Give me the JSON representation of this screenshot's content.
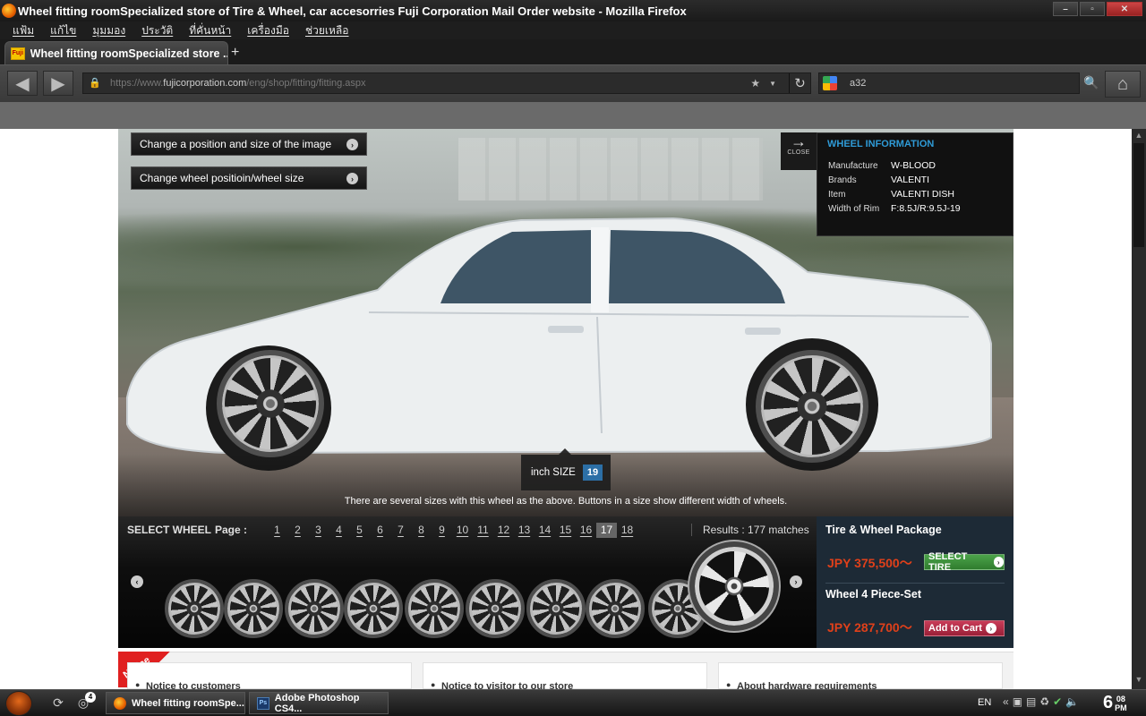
{
  "window": {
    "title": "Wheel fitting roomSpecialized store of Tire & Wheel, car accesorries Fuji Corporation Mail Order website - Mozilla Firefox",
    "controls": [
      "–",
      "▫",
      "✕"
    ]
  },
  "menu": [
    "แฟ้ม",
    "แก้ไข",
    "มุมมอง",
    "ประวัติ",
    "ที่คั่นหน้า",
    "เครื่องมือ",
    "ช่วยเหลือ"
  ],
  "tab": {
    "favicon": "Fuji",
    "label": "Wheel fitting roomSpecialized store ...",
    "new_tab": "+"
  },
  "nav": {
    "url_prefix": "https://www.",
    "url_domain": "fujicorporation.com",
    "url_path": "/eng/shop/fitting/fitting.aspx",
    "search_value": "a32"
  },
  "scene": {
    "btn_position": "Change a position and size of the image",
    "btn_wheel": "Change wheel positioin/wheel size",
    "close_label": "CLOSE",
    "info_title": "WHEEL INFORMATION",
    "info": [
      {
        "k": "Manufacture",
        "v": "W-BLOOD"
      },
      {
        "k": "Brands",
        "v": "VALENTI"
      },
      {
        "k": "Item",
        "v": "VALENTI DISH"
      },
      {
        "k": "Width of Rim",
        "v": "F:8.5J/R:9.5J-19"
      }
    ],
    "inch_label": "inch SIZE",
    "inch_value": "19",
    "note": "There are several sizes with this wheel as the above. Buttons in a size show different width of wheels."
  },
  "selector": {
    "title": "SELECT WHEEL",
    "page_label": "Page :",
    "pages": [
      "1",
      "2",
      "3",
      "4",
      "5",
      "6",
      "7",
      "8",
      "9",
      "10",
      "11",
      "12",
      "13",
      "14",
      "15",
      "16",
      "17",
      "18"
    ],
    "current_page": "17",
    "results": "Results : 177 matches"
  },
  "package": {
    "tire_title": "Tire & Wheel Package",
    "tire_price": "JPY 375,500〜",
    "tire_btn": "SELECT TIRE",
    "set_title": "Wheel 4 Piece-Set",
    "set_price": "JPY 287,700〜",
    "set_btn": "Add to Cart"
  },
  "notice": {
    "ribbon": "Notice",
    "cards": [
      "Notice to customers",
      "Notice to visitor to our store",
      "About hardware requirements"
    ]
  },
  "taskbar": {
    "badge": "4",
    "tasks": [
      "Wheel fitting roomSpe...",
      "Adobe Photoshop CS4..."
    ],
    "lang": "EN",
    "hour": "6",
    "minute": "08",
    "ampm": "PM"
  }
}
